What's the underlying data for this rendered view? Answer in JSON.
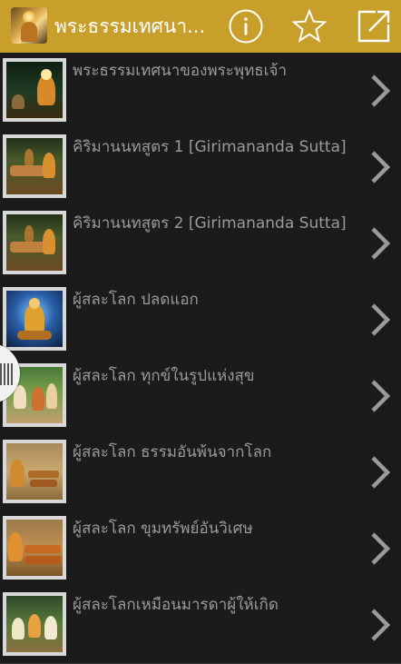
{
  "appbar": {
    "title": "พระธรรมเทศนา...",
    "icon": "buddha-app-icon",
    "info_icon": "info-icon",
    "favorite_icon": "star-icon",
    "open_icon": "open-external-icon",
    "background_color": "#c99f2b"
  },
  "list": {
    "items": [
      {
        "title": "พระธรรมเทศนาของพระพุทธเจ้า",
        "thumb": "buddha-night-scene"
      },
      {
        "title": "คิริมานนทสูตร 1 [Girimananda Sutta]",
        "thumb": "sick-monk-scene"
      },
      {
        "title": "คิริมานนทสูตร 2 [Girimananda Sutta]",
        "thumb": "sick-monk-scene"
      },
      {
        "title": "ผู้สละโลก ปลดแอก",
        "thumb": "meditating-buddha-blue"
      },
      {
        "title": "ผู้สละโลก ทุกข์ในรูปแห่งสุข",
        "thumb": "garden-scene"
      },
      {
        "title": "ผู้สละโลก ธรรมอันพ้นจากโลก",
        "thumb": "assembly-scene"
      },
      {
        "title": "ผู้สละโลก ขุมทรัพย์อันวิเศษ",
        "thumb": "monks-assembly"
      },
      {
        "title": "ผู้สละโลกเหมือนมารดาผู้ให้เกิด",
        "thumb": "teaching-scene"
      }
    ],
    "chevron_icon": "chevron-right-icon"
  },
  "side_handle_icon": "drawer-handle-icon"
}
